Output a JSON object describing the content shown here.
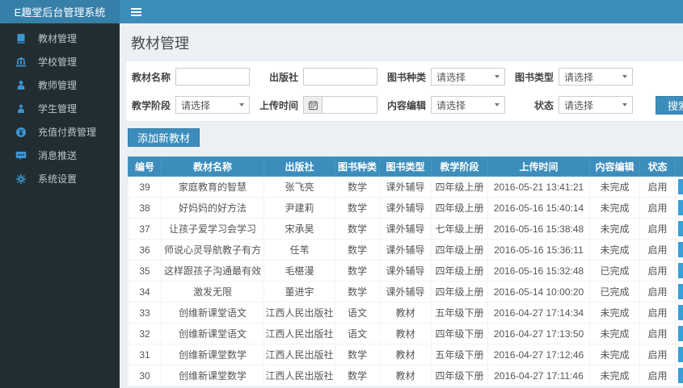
{
  "colors": {
    "accent": "#3c8dbc",
    "logo_bg": "#367fa9",
    "sidebar_bg": "#222d32",
    "sidebar_icon_blue": "#3b95d2",
    "content_bg": "#ecf0f5",
    "table_header_bg": "#3c8dbc",
    "row_action_blue": "#36a0d9"
  },
  "navbar": {
    "title": "E趣堂后台管理系统"
  },
  "sidebar": {
    "items": [
      {
        "label": "教材管理",
        "icon": "book-icon"
      },
      {
        "label": "学校管理",
        "icon": "bank-icon"
      },
      {
        "label": "教师管理",
        "icon": "teacher-icon"
      },
      {
        "label": "学生管理",
        "icon": "student-icon"
      },
      {
        "label": "充值付费管理",
        "icon": "coin-icon"
      },
      {
        "label": "消息推送",
        "icon": "comment-icon"
      },
      {
        "label": "系统设置",
        "icon": "gear-icon"
      }
    ]
  },
  "page": {
    "title": "教材管理"
  },
  "filters": {
    "rows": [
      [
        {
          "label": "教材名称",
          "type": "text",
          "value": "",
          "placeholder": ""
        },
        {
          "label": "出版社",
          "type": "text",
          "value": "",
          "placeholder": ""
        },
        {
          "label": "图书种类",
          "type": "select",
          "value": "请选择"
        },
        {
          "label": "图书类型",
          "type": "select",
          "value": "请选择"
        }
      ],
      [
        {
          "label": "教学阶段",
          "type": "select",
          "value": "请选择"
        },
        {
          "label": "上传时间",
          "type": "date",
          "value": "",
          "icon": "calendar-icon"
        },
        {
          "label": "内容编辑",
          "type": "select",
          "value": "请选择"
        },
        {
          "label": "状态",
          "type": "select",
          "value": "请选择"
        }
      ]
    ],
    "search_label": "搜索"
  },
  "toolbar": {
    "add_button_label": "添加新教材"
  },
  "table": {
    "headers": [
      "编号",
      "教材名称",
      "出版社",
      "图书种类",
      "图书类型",
      "教学阶段",
      "上传时间",
      "内容编辑",
      "状态",
      ""
    ],
    "rows": [
      [
        "39",
        "家庭教育的智慧",
        "张飞亮",
        "数学",
        "课外辅导",
        "四年级上册",
        "2016-05-21 13:41:21",
        "未完成",
        "启用"
      ],
      [
        "38",
        "好妈妈的好方法",
        "尹建莉",
        "数学",
        "课外辅导",
        "四年级上册",
        "2016-05-16 15:40:14",
        "未完成",
        "启用"
      ],
      [
        "37",
        "让孩子爱学习会学习",
        "宋承昊",
        "数学",
        "课外辅导",
        "七年级上册",
        "2016-05-16 15:38:48",
        "未完成",
        "启用"
      ],
      [
        "36",
        "师说心灵导航教子有方",
        "任苇",
        "数学",
        "课外辅导",
        "四年级上册",
        "2016-05-16 15:36:11",
        "未完成",
        "启用"
      ],
      [
        "35",
        "这样跟孩子沟通最有效",
        "毛椹漫",
        "数学",
        "课外辅导",
        "四年级上册",
        "2016-05-16 15:32:48",
        "已完成",
        "启用"
      ],
      [
        "34",
        "激发无限",
        "董进宇",
        "数学",
        "课外辅导",
        "四年级上册",
        "2016-05-14 10:00:20",
        "已完成",
        "启用"
      ],
      [
        "33",
        "创维新课堂语文",
        "江西人民出版社",
        "语文",
        "教材",
        "五年级下册",
        "2016-04-27 17:14:34",
        "未完成",
        "启用"
      ],
      [
        "32",
        "创维新课堂语文",
        "江西人民出版社",
        "语文",
        "教材",
        "四年级下册",
        "2016-04-27 17:13:50",
        "未完成",
        "启用"
      ],
      [
        "31",
        "创维新课堂数学",
        "江西人民出版社",
        "数学",
        "教材",
        "五年级下册",
        "2016-04-27 17:12:46",
        "未完成",
        "启用"
      ],
      [
        "30",
        "创维新课堂数学",
        "江西人民出版社",
        "数学",
        "教材",
        "四年级下册",
        "2016-04-27 17:11:46",
        "未完成",
        "启用"
      ]
    ]
  }
}
